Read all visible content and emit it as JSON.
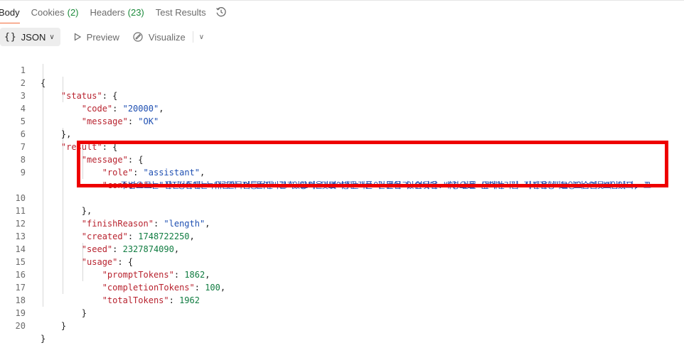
{
  "tabs": [
    {
      "label": "Body",
      "count": ""
    },
    {
      "label": "Cookies",
      "count": "(2)"
    },
    {
      "label": "Headers",
      "count": "(23)"
    },
    {
      "label": "Test Results",
      "count": ""
    }
  ],
  "toolbar": {
    "format_label": "JSON",
    "preview_label": "Preview",
    "visualize_label": "Visualize"
  },
  "code_lines": [
    {
      "n": "1"
    },
    {
      "n": "2"
    },
    {
      "n": "3"
    },
    {
      "n": "4"
    },
    {
      "n": "5"
    },
    {
      "n": "6"
    },
    {
      "n": "7"
    },
    {
      "n": "8"
    },
    {
      "n": "9"
    },
    {
      "n": "10"
    },
    {
      "n": "11"
    },
    {
      "n": "12"
    },
    {
      "n": "13"
    },
    {
      "n": "14"
    },
    {
      "n": "15"
    },
    {
      "n": "16"
    },
    {
      "n": "17"
    },
    {
      "n": "18"
    },
    {
      "n": "19"
    },
    {
      "n": "20"
    }
  ],
  "json": {
    "status_key": "\"status\"",
    "code_key": "\"code\"",
    "code_val": "\"20000\"",
    "message_key": "\"message\"",
    "message_val": "\"OK\"",
    "result_key": "\"result\"",
    "result_message_key": "\"message\"",
    "role_key": "\"role\"",
    "role_val": "\"assistant\"",
    "content_key": "\"content\"",
    "content_val_1": "\"사진 속에는 유럽의 전통적인 건축 양식을 보여주는 큰 건물이 있습니다. 이 건물 앞에는 긴 직사각형 모양의 연못이 있고, 그",
    "content_val_2": "주변으로는 잘 정돈된 녹색 관목이 둘러싸고 있으며 몇몇 방문객들이 건물과 연못을 배경으로 산책하거나 사진을 찍는 모습이 보입니다. \"",
    "finish_key": "\"finishReason\"",
    "finish_val": "\"length\"",
    "created_key": "\"created\"",
    "created_val": "1748722250",
    "seed_key": "\"seed\"",
    "seed_val": "2327874090",
    "usage_key": "\"usage\"",
    "prompt_key": "\"promptTokens\"",
    "prompt_val": "1862",
    "completion_key": "\"completionTokens\"",
    "completion_val": "100",
    "total_key": "\"totalTokens\"",
    "total_val": "1962"
  },
  "icons": {
    "history": "history-icon",
    "preview": "play-icon",
    "visualize": "visualize-icon"
  },
  "colors": {
    "key": "#b8232f",
    "string": "#1e4fb2",
    "number": "#107c41",
    "active_tab_underline": "#f26b3a",
    "highlight_box": "#ee0000"
  }
}
